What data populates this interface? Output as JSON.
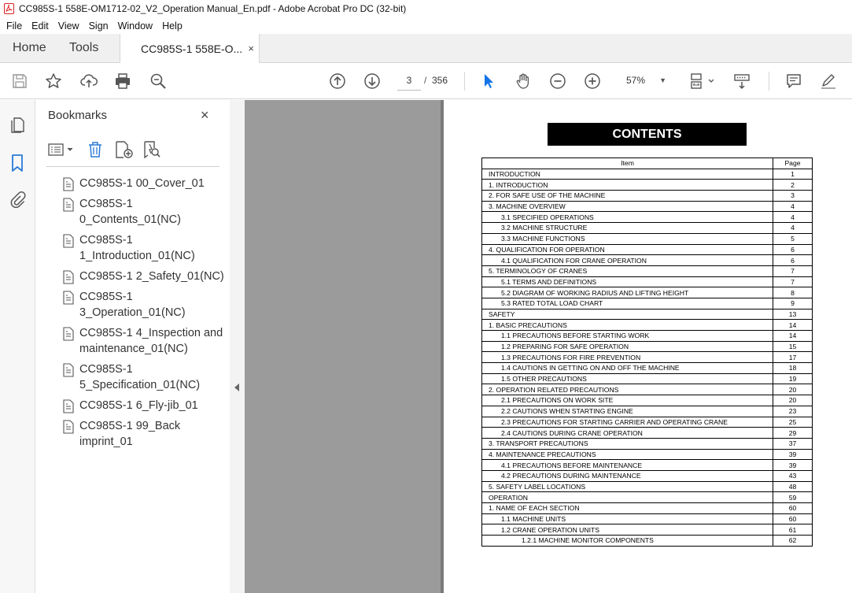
{
  "window": {
    "title": "CC985S-1 558E-OM1712-02_V2_Operation Manual_En.pdf - Adobe Acrobat Pro DC (32-bit)"
  },
  "menu": [
    "File",
    "Edit",
    "View",
    "Sign",
    "Window",
    "Help"
  ],
  "tabs": {
    "home": "Home",
    "tools": "Tools",
    "document": "CC985S-1 558E-O...",
    "close": "×"
  },
  "toolbar": {
    "current_page": "3",
    "page_separator": "/",
    "total_pages": "356",
    "zoom": "57%"
  },
  "bookmarks": {
    "title": "Bookmarks",
    "close": "×",
    "items": [
      "CC985S-1 00_Cover_01",
      "CC985S-1 0_Contents_01(NC)",
      "CC985S-1 1_Introduction_01(NC)",
      "CC985S-1 2_Safety_01(NC)",
      "CC985S-1 3_Operation_01(NC)",
      "CC985S-1 4_Inspection and maintenance_01(NC)",
      "CC985S-1 5_Specification_01(NC)",
      "CC985S-1 6_Fly-jib_01",
      "CC985S-1 99_Back imprint_01"
    ]
  },
  "document": {
    "heading": "CONTENTS",
    "col_item": "Item",
    "col_page": "Page",
    "rows": [
      {
        "item": "INTRODUCTION",
        "page": "1",
        "level": 0
      },
      {
        "item": "1. INTRODUCTION",
        "page": "2",
        "level": 0
      },
      {
        "item": "2. FOR SAFE USE OF THE MACHINE",
        "page": "3",
        "level": 0
      },
      {
        "item": "3. MACHINE OVERVIEW",
        "page": "4",
        "level": 0
      },
      {
        "item": "3.1 SPECIFIED OPERATIONS",
        "page": "4",
        "level": 1
      },
      {
        "item": "3.2 MACHINE STRUCTURE",
        "page": "4",
        "level": 1
      },
      {
        "item": "3.3 MACHINE FUNCTIONS",
        "page": "5",
        "level": 1
      },
      {
        "item": "4. QUALIFICATION FOR OPERATION",
        "page": "6",
        "level": 0
      },
      {
        "item": "4.1 QUALIFICATION FOR CRANE OPERATION",
        "page": "6",
        "level": 1
      },
      {
        "item": "5. TERMINOLOGY OF CRANES",
        "page": "7",
        "level": 0
      },
      {
        "item": "5.1 TERMS AND DEFINITIONS",
        "page": "7",
        "level": 1
      },
      {
        "item": "5.2 DIAGRAM OF WORKING RADIUS AND LIFTING HEIGHT",
        "page": "8",
        "level": 1
      },
      {
        "item": "5.3 RATED TOTAL LOAD CHART",
        "page": "9",
        "level": 1
      },
      {
        "item": "SAFETY",
        "page": "13",
        "level": 0
      },
      {
        "item": "1. BASIC PRECAUTIONS",
        "page": "14",
        "level": 0
      },
      {
        "item": "1.1 PRECAUTIONS BEFORE STARTING WORK",
        "page": "14",
        "level": 1
      },
      {
        "item": "1.2 PREPARING FOR SAFE OPERATION",
        "page": "15",
        "level": 1
      },
      {
        "item": "1.3 PRECAUTIONS FOR FIRE PREVENTION",
        "page": "17",
        "level": 1
      },
      {
        "item": "1.4 CAUTIONS IN GETTING ON AND OFF THE MACHINE",
        "page": "18",
        "level": 1
      },
      {
        "item": "1.5 OTHER PRECAUTIONS",
        "page": "19",
        "level": 1
      },
      {
        "item": "2. OPERATION RELATED PRECAUTIONS",
        "page": "20",
        "level": 0
      },
      {
        "item": "2.1 PRECAUTIONS ON WORK SITE",
        "page": "20",
        "level": 1
      },
      {
        "item": "2.2 CAUTIONS WHEN STARTING ENGINE",
        "page": "23",
        "level": 1
      },
      {
        "item": "2.3 PRECAUTIONS FOR STARTING CARRIER AND OPERATING CRANE",
        "page": "25",
        "level": 1
      },
      {
        "item": "2.4 CAUTIONS DURING CRANE OPERATION",
        "page": "29",
        "level": 1
      },
      {
        "item": "3. TRANSPORT PRECAUTIONS",
        "page": "37",
        "level": 0
      },
      {
        "item": "4. MAINTENANCE PRECAUTIONS",
        "page": "39",
        "level": 0
      },
      {
        "item": "4.1 PRECAUTIONS BEFORE MAINTENANCE",
        "page": "39",
        "level": 1
      },
      {
        "item": "4.2 PRECAUTIONS DURING MAINTENANCE",
        "page": "43",
        "level": 1
      },
      {
        "item": "5. SAFETY LABEL LOCATIONS",
        "page": "48",
        "level": 0
      },
      {
        "item": "OPERATION",
        "page": "59",
        "level": 0
      },
      {
        "item": "1. NAME OF EACH SECTION",
        "page": "60",
        "level": 0
      },
      {
        "item": "1.1 MACHINE UNITS",
        "page": "60",
        "level": 1
      },
      {
        "item": "1.2 CRANE OPERATION UNITS",
        "page": "61",
        "level": 1
      },
      {
        "item": "1.2.1 MACHINE MONITOR COMPONENTS",
        "page": "62",
        "level": 2
      }
    ]
  },
  "colors": {
    "accent_blue": "#2a7ad6",
    "pointer_blue": "#1473e6",
    "doc_background": "#9b9b9b"
  },
  "icons": [
    "save-icon",
    "star-icon",
    "upload-icon",
    "print-icon",
    "zoom-search-icon",
    "page-up-icon",
    "page-down-icon",
    "select-arrow-icon",
    "hand-icon",
    "zoom-out-icon",
    "zoom-in-icon",
    "fit-page-icon",
    "scroll-mode-icon",
    "comment-icon",
    "pen-icon",
    "pages-icon",
    "bookmark-icon",
    "attachment-icon",
    "options-icon",
    "delete-icon",
    "new-bookmark-icon",
    "bookmark-search-icon"
  ]
}
